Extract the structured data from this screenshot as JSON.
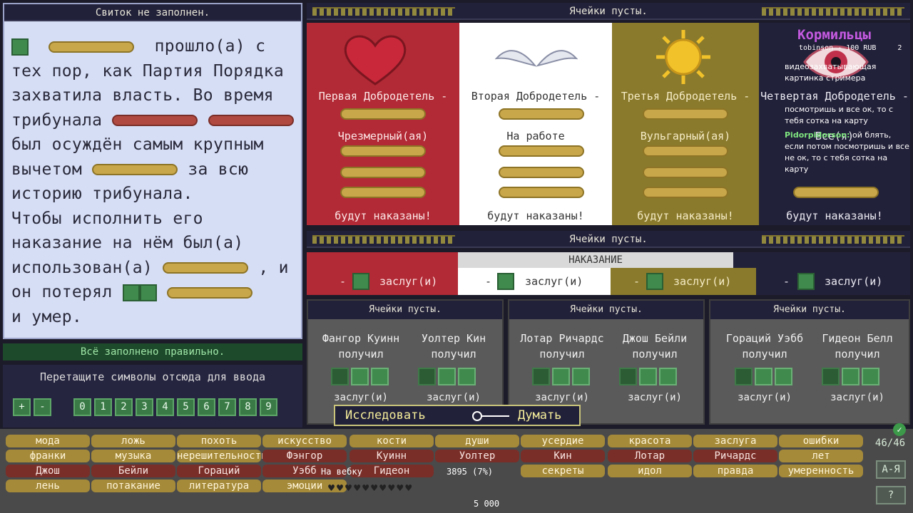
{
  "scroll": {
    "title": "Свиток не заполнен.",
    "lines": {
      "l1": "прошло(а) с",
      "l2": "тех пор, как Партия Порядка",
      "l3": "захватила власть. Во время",
      "l4": "трибунала",
      "l5": "был осуждён самым крупным",
      "l6a": "вычетом",
      "l6b": "за всю",
      "l7": "историю трибунала.",
      "l8": "Чтобы исполнить его",
      "l9": "наказание на нём был(а)",
      "l10a": "использован(а)",
      "l10b": ", и",
      "l11": "он потерял",
      "l12": "и умер."
    }
  },
  "status": "Всё заполнено правильно.",
  "drag_panel": {
    "label": "Перетащите символы отсюда для ввода",
    "keys": [
      "+",
      "-",
      "0",
      "1",
      "2",
      "3",
      "4",
      "5",
      "6",
      "7",
      "8",
      "9"
    ]
  },
  "virtues": {
    "header": "Ячейки пусты.",
    "columns": [
      {
        "name": "Первая Добродетель -",
        "mid": "Чрезмерный(ая)",
        "end": "будут наказаны!",
        "bg": "#b12a35"
      },
      {
        "name": "Вторая Добродетель -",
        "mid": "На работе",
        "end": "будут наказаны!",
        "bg": "#ffffff"
      },
      {
        "name": "Третья Добродетель -",
        "mid": "Вульгарный(ая)",
        "end": "будут наказаны!",
        "bg": "#8a7a2c"
      },
      {
        "name": "Четвертая Добродетель -",
        "mid": "Все(я)",
        "end": "будут наказаны!",
        "bg": "#22213a"
      }
    ]
  },
  "punishment": {
    "header": "Ячейки пусты.",
    "title": "НАКАЗАНИЕ",
    "cells": [
      {
        "dash": "-",
        "label": "заслуг(и)"
      },
      {
        "dash": "-",
        "label": "заслуг(и)"
      },
      {
        "dash": "-",
        "label": "заслуг(и)"
      },
      {
        "dash": "-",
        "label": "заслуг(и)"
      }
    ]
  },
  "trials": [
    {
      "header": "Ячейки пусты.",
      "p1": "Фангор Куинн",
      "p2": "Уолтер Кин",
      "got": "получил",
      "merit": "заслуг(и)"
    },
    {
      "header": "Ячейки пусты.",
      "p1": "Лотар Ричардс",
      "p2": "Джош Бейли",
      "got": "получил",
      "merit": "заслуг(и)"
    },
    {
      "header": "Ячейки пусты.",
      "p1": "Гораций Уэбб",
      "p2": "Гидеон Белл",
      "got": "получил",
      "merit": "заслуг(и)"
    }
  ],
  "actions": {
    "explore": "Исследовать",
    "think": "Думать"
  },
  "word_bank": {
    "rows": [
      [
        "мода",
        "ложь",
        "похоть",
        "искусство",
        "кости",
        "души",
        "усердие",
        "красота",
        "заслуга",
        "ошибки"
      ],
      [
        "франки",
        "музыка",
        "нерешительность",
        "Фэнгор",
        "Куинн",
        "Уолтер",
        "Кин",
        "Лотар",
        "Ричардс",
        "лет"
      ],
      [
        "Джош",
        "Бейли",
        "Гораций",
        "Уэбб",
        "Гидеон",
        "",
        "секреты",
        "идол",
        "правда",
        "умеренность"
      ],
      [
        "лень",
        "потакание",
        "литература",
        "эмоции"
      ]
    ],
    "counter": "46/46",
    "sort_btn": "А-Я",
    "help_btn": "?"
  },
  "overlay": {
    "channel": "Кормильцы",
    "donor": "tobinson",
    "donation": "- 100 RUB",
    "donation_count": "2",
    "chat": [
      {
        "user": "",
        "text": "видеозахватывающая картинка стримера"
      },
      {
        "user": "",
        "text": "посмотришь и все ок, то с тебя сотка на карту"
      },
      {
        "user": "Pidorpidorson:",
        "text": "ой блять, если потом посмотришь и все не ок, то с тебя сотка на карту"
      }
    ],
    "bottom_label": "На вебку",
    "money": "5 000",
    "progress_text": "3895 (7%)"
  }
}
